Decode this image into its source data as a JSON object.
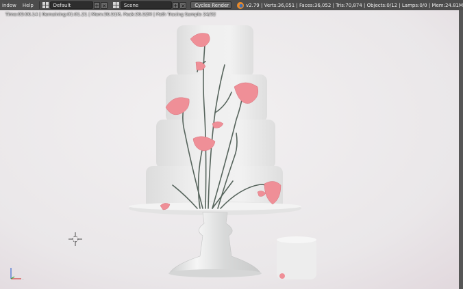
{
  "header": {
    "menu_window": "indow",
    "menu_help": "Help",
    "layout": "Default",
    "scene": "Scene",
    "render_engine": "Cycles Render",
    "stats": "v2.79 | Verts:36,051 | Faces:36,052 | Tris:70,874 | Objects:0/12 | Lamps:0/0 | Mem:24.81M",
    "plus_label": "+",
    "close_label": "×"
  },
  "viewport": {
    "render_status": "Time:03:06.14 | Remaining:01:01.21 | Mem:36.51M, Peak:36.52M | Path Tracing Sample 24/32"
  },
  "colors": {
    "background": "#ebe9ea",
    "petal": "#ef8f97",
    "stem": "#56645c",
    "header": "#4c4c4c"
  }
}
